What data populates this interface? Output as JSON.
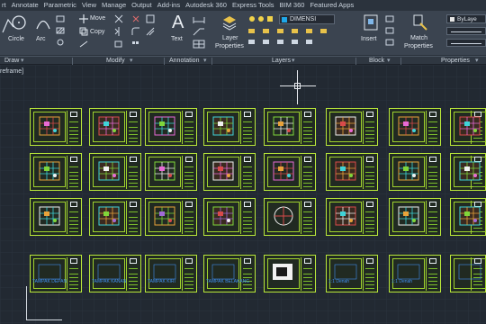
{
  "menubar": {
    "items": [
      "rt",
      "Annotate",
      "Parametric",
      "View",
      "Manage",
      "Output",
      "Add-ins",
      "Autodesk 360",
      "Express Tools",
      "BIM 360",
      "Featured Apps"
    ]
  },
  "ribbon": {
    "circle_label": "Circle",
    "arc_label": "Arc",
    "move_label": "Move",
    "copy_label": "Copy",
    "text_label": "Text",
    "layer_props_label_1": "Layer",
    "layer_props_label_2": "Properties",
    "layer_dropdown_value": "DIMENSI",
    "insert_label": "Insert",
    "match_props_label_1": "Match",
    "match_props_label_2": "Properties",
    "bylayer_value": "ByLaye"
  },
  "panels": [
    "Draw",
    "Modify",
    "Annotation",
    "Layers",
    "Block",
    "Properties"
  ],
  "view_label": "reframe]",
  "sheets": {
    "row4_titles": [
      "TAMPAK DEPAN",
      "TAMPAK KANAN",
      "TAMPAK KIRI",
      "TAMPAK BELAKANG",
      "",
      "",
      "",
      ""
    ],
    "row4_small": [
      "",
      "",
      "",
      "",
      "",
      "1:1 Denah",
      "1:1 Denah",
      ""
    ]
  },
  "colors": {
    "frame": "#b9e83a",
    "canvas": "#222932",
    "ribbon": "#3b4450",
    "accent_blue": "#3f8ff0"
  },
  "icons": [
    "circle-icon",
    "arc-icon",
    "move-icon",
    "copy-icon",
    "text-icon",
    "layer-properties-icon",
    "insert-icon",
    "match-properties-icon",
    "crosshair-icon",
    "ucs-icon"
  ]
}
